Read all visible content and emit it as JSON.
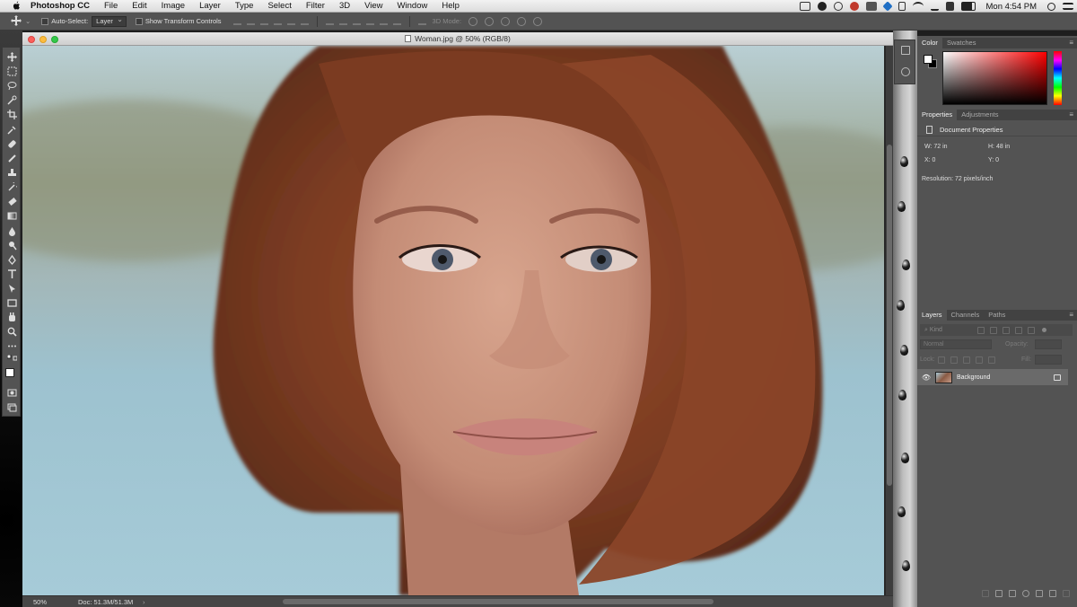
{
  "menubar": {
    "app_name": "Photoshop CC",
    "items": [
      "File",
      "Edit",
      "Image",
      "Layer",
      "Type",
      "Select",
      "Filter",
      "3D",
      "View",
      "Window",
      "Help"
    ],
    "clock": "Mon 4:54 PM"
  },
  "options_bar": {
    "auto_select_label": "Auto-Select:",
    "auto_select_value": "Layer",
    "transform_label": "Show Transform Controls",
    "mode_label": "3D Mode:"
  },
  "document": {
    "title": "Woman.jpg @ 50% (RGB/8)",
    "zoom": "50%",
    "doc_size": "Doc: 51.3M/51.3M",
    "status_arrow": "›"
  },
  "color_panel": {
    "tabs": [
      "Color",
      "Swatches"
    ],
    "foreground": "#ffffff",
    "background": "#000000",
    "hue": "#ff0000"
  },
  "properties_panel": {
    "tabs": [
      "Properties",
      "Adjustments"
    ],
    "heading": "Document Properties",
    "width": "W: 72 in",
    "height": "H: 48 in",
    "x": "X: 0",
    "y": "Y: 0",
    "resolution": "Resolution: 72 pixels/inch"
  },
  "layers_panel": {
    "tabs": [
      "Layers",
      "Channels",
      "Paths"
    ],
    "filter_placeholder": "Kind",
    "blend_mode": "Normal",
    "opacity_label": "Opacity:",
    "lock_label": "Lock:",
    "fill_label": "Fill:",
    "layers": [
      {
        "name": "Background",
        "visible": true,
        "locked": true
      }
    ]
  }
}
